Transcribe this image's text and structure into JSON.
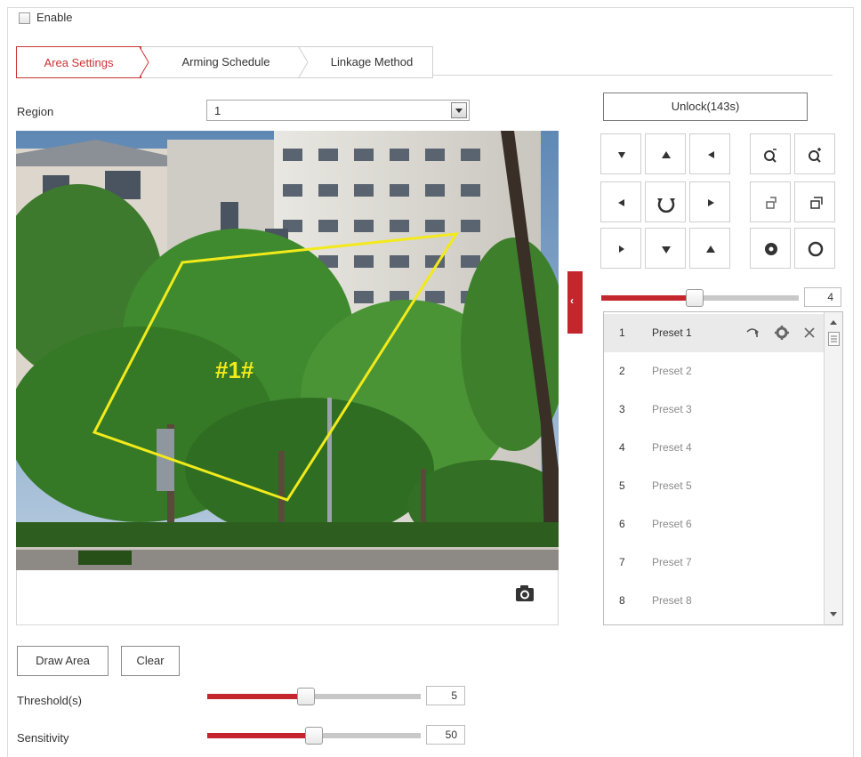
{
  "enable": {
    "label": "Enable",
    "checked": false
  },
  "tabs": [
    {
      "label": "Area Settings",
      "active": true
    },
    {
      "label": "Arming Schedule",
      "active": false
    },
    {
      "label": "Linkage Method",
      "active": false
    }
  ],
  "region": {
    "label": "Region",
    "value": "1"
  },
  "video": {
    "area_label": "#1#",
    "area_color": "#f2ea1a"
  },
  "ptz": {
    "unlock_label": "Unlock(143s)",
    "speed": {
      "value": "4",
      "fraction": 0.47
    },
    "accent_color": "#c3262d",
    "buttons": [
      "pan-up-left",
      "pan-up",
      "pan-up-right",
      "zoom-out",
      "zoom-in",
      "pan-left",
      "auto-rotate",
      "pan-right",
      "focus-near",
      "focus-far",
      "pan-down-left",
      "pan-down",
      "pan-down-right",
      "iris-close",
      "iris-open"
    ]
  },
  "presets": [
    {
      "num": "1",
      "name": "Preset 1",
      "selected": true
    },
    {
      "num": "2",
      "name": "Preset 2",
      "selected": false
    },
    {
      "num": "3",
      "name": "Preset 3",
      "selected": false
    },
    {
      "num": "4",
      "name": "Preset 4",
      "selected": false
    },
    {
      "num": "5",
      "name": "Preset 5",
      "selected": false
    },
    {
      "num": "6",
      "name": "Preset 6",
      "selected": false
    },
    {
      "num": "7",
      "name": "Preset 7",
      "selected": false
    },
    {
      "num": "8",
      "name": "Preset 8",
      "selected": false
    }
  ],
  "actions": {
    "draw_area": "Draw Area",
    "clear": "Clear"
  },
  "threshold": {
    "label": "Threshold(s)",
    "value": "5",
    "fraction": 0.46
  },
  "sensitivity": {
    "label": "Sensitivity",
    "value": "50",
    "fraction": 0.5
  }
}
